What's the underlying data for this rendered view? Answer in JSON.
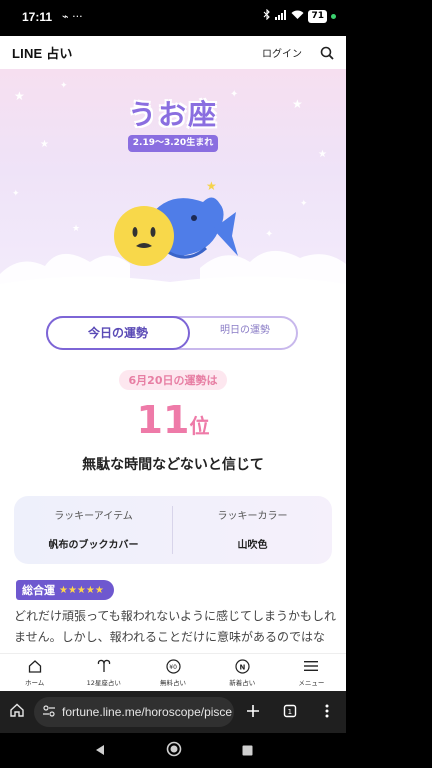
{
  "status_bar": {
    "time": "17:11",
    "notif_icons": "⌁ ···",
    "battery": "71"
  },
  "header": {
    "logo": "LINE 占い",
    "login": "ログイン"
  },
  "hero": {
    "sign_name": "うお座",
    "date_range": "2.19〜3.20生まれ"
  },
  "tabs": {
    "today": "今日の運勢",
    "tomorrow": "明日の運勢"
  },
  "fortune": {
    "date_label": "6月20日の運勢は",
    "rank_number": "11",
    "rank_unit": "位",
    "headline": "無駄な時間などないと信じて"
  },
  "lucky": {
    "item_title": "ラッキーアイテム",
    "item_value": "帆布のブックカバー",
    "color_title": "ラッキーカラー",
    "color_value": "山吹色"
  },
  "overall": {
    "label": "総合運",
    "stars": "★★★★★",
    "text": "どれだけ頑張っても報われないように感じてしまうかもしれません。しかし、報われることだけに意味があるのではない"
  },
  "bottom_nav": [
    {
      "label": "ホーム",
      "icon": "home-icon"
    },
    {
      "label": "12星座占い",
      "icon": "aries-icon"
    },
    {
      "label": "無料占い",
      "icon": "free-icon"
    },
    {
      "label": "新着占い",
      "icon": "new-icon"
    },
    {
      "label": "メニュー",
      "icon": "menu-icon"
    }
  ],
  "browser": {
    "url": "fortune.line.me/horoscope/pisce"
  },
  "colors": {
    "accent": "#7d65d6",
    "rank": "#ee7aa8",
    "badge": "#6e58cf"
  }
}
